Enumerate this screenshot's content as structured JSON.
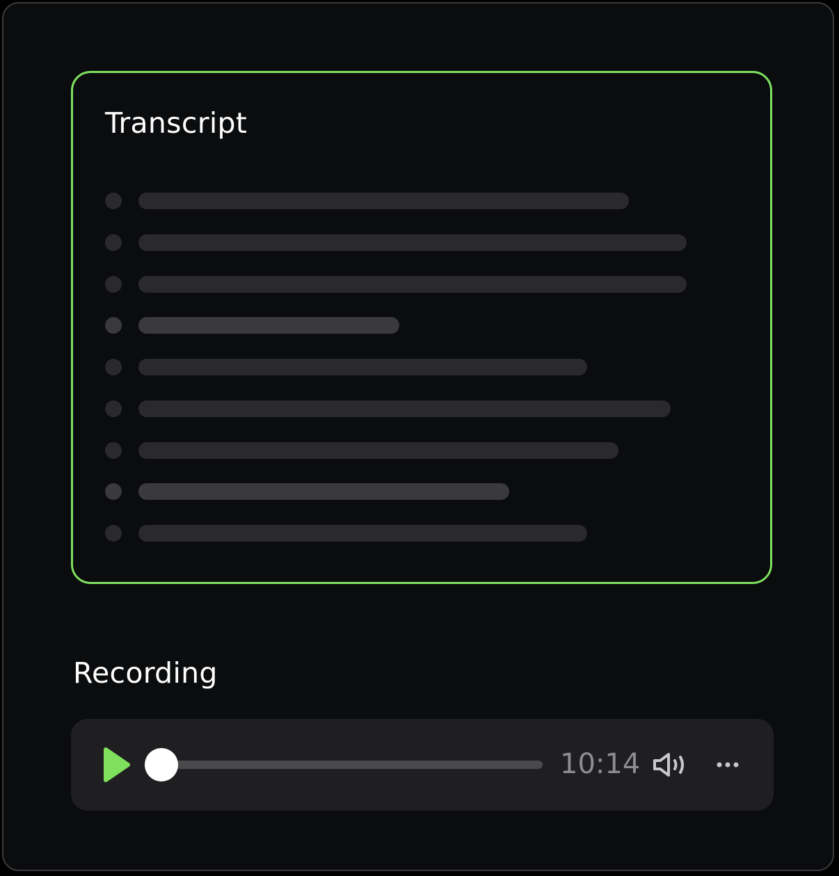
{
  "transcript": {
    "title": "Transcript",
    "lines": [
      {
        "fill": 0.94,
        "shade": "dark"
      },
      {
        "fill": 1.05,
        "shade": "dark"
      },
      {
        "fill": 1.05,
        "shade": "dark"
      },
      {
        "fill": 0.5,
        "shade": "light"
      },
      {
        "fill": 0.86,
        "shade": "dark"
      },
      {
        "fill": 1.02,
        "shade": "dark"
      },
      {
        "fill": 0.92,
        "shade": "dark"
      },
      {
        "fill": 0.71,
        "shade": "light"
      },
      {
        "fill": 0.86,
        "shade": "dark"
      }
    ]
  },
  "recording": {
    "title": "Recording",
    "time": "10:14",
    "progress": 0.0,
    "play_icon": "play-icon",
    "volume_icon": "volume-icon",
    "more_icon": "more-options-icon"
  },
  "colors": {
    "accent": "#7fe05e",
    "background": "#0b0c0e",
    "player_background": "#1f1f21",
    "placeholder_dark": "#2a2a2c",
    "placeholder_light": "#3a3a3c",
    "time_text": "#8d8d91"
  }
}
